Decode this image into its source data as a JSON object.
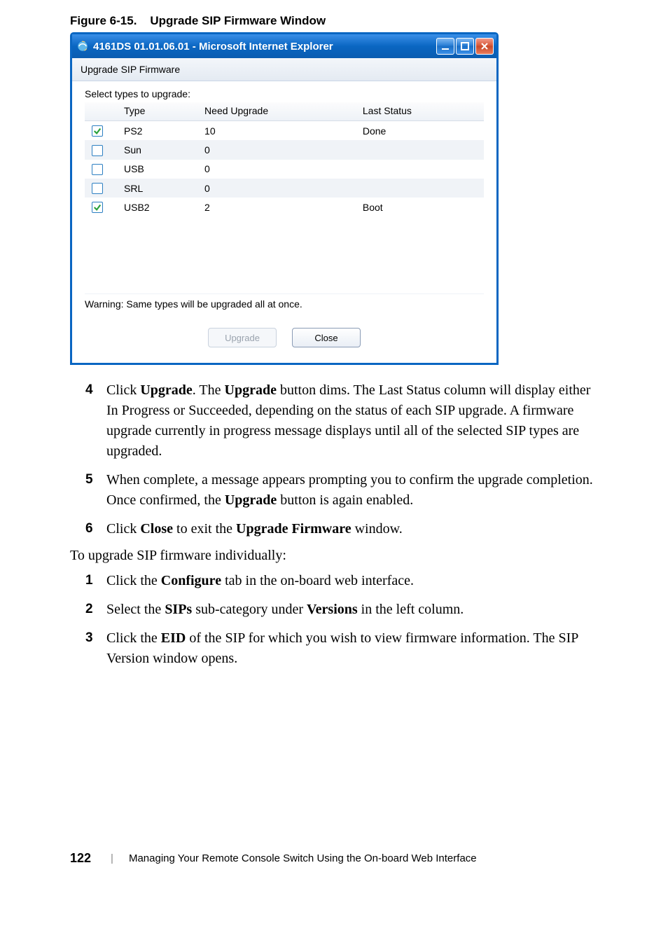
{
  "figure": {
    "label": "Figure 6-15.",
    "title": "Upgrade SIP Firmware Window"
  },
  "window": {
    "title": "4161DS 01.01.06.01 - Microsoft Internet Explorer",
    "subheader": "Upgrade SIP Firmware",
    "select_label": "Select types to upgrade:",
    "columns": {
      "type": "Type",
      "need": "Need Upgrade",
      "last": "Last Status"
    },
    "rows": [
      {
        "checked": true,
        "type": "PS2",
        "need": "10",
        "last": "Done"
      },
      {
        "checked": false,
        "type": "Sun",
        "need": "0",
        "last": ""
      },
      {
        "checked": false,
        "type": "USB",
        "need": "0",
        "last": ""
      },
      {
        "checked": false,
        "type": "SRL",
        "need": "0",
        "last": ""
      },
      {
        "checked": true,
        "type": "USB2",
        "need": "2",
        "last": "Boot"
      }
    ],
    "warning": "Warning: Same types will be upgraded all at once.",
    "buttons": {
      "upgrade": "Upgrade",
      "close": "Close"
    }
  },
  "step4": {
    "num": "4",
    "p1a": "Click ",
    "p1b": "Upgrade",
    "p1c": ". The ",
    "p1d": "Upgrade",
    "p1e": " button dims. The Last Status column will display either In Progress or Succeeded, depending on the status of each SIP upgrade. A firmware upgrade currently in progress message displays until all of the selected SIP types are upgraded."
  },
  "step5": {
    "num": "5",
    "p1a": "When complete, a message appears prompting you to confirm the upgrade completion. Once confirmed, the ",
    "p1b": "Upgrade",
    "p1c": " button is again enabled."
  },
  "step6": {
    "num": "6",
    "p1a": "Click ",
    "p1b": "Close",
    "p1c": " to exit the ",
    "p1d": "Upgrade Firmware",
    "p1e": " window."
  },
  "intro2": "To upgrade SIP firmware individually:",
  "stepB1": {
    "num": "1",
    "p1a": "Click the ",
    "p1b": "Configure",
    "p1c": " tab in the on-board web interface."
  },
  "stepB2": {
    "num": "2",
    "p1a": "Select the ",
    "p1b": "SIPs",
    "p1c": " sub-category under ",
    "p1d": "Versions",
    "p1e": " in the left column."
  },
  "stepB3": {
    "num": "3",
    "p1a": "Click the ",
    "p1b": "EID",
    "p1c": " of the SIP for which you wish to view firmware information. The SIP Version window opens."
  },
  "footer": {
    "page": "122",
    "text": "Managing Your Remote Console Switch Using the On-board Web Interface"
  }
}
